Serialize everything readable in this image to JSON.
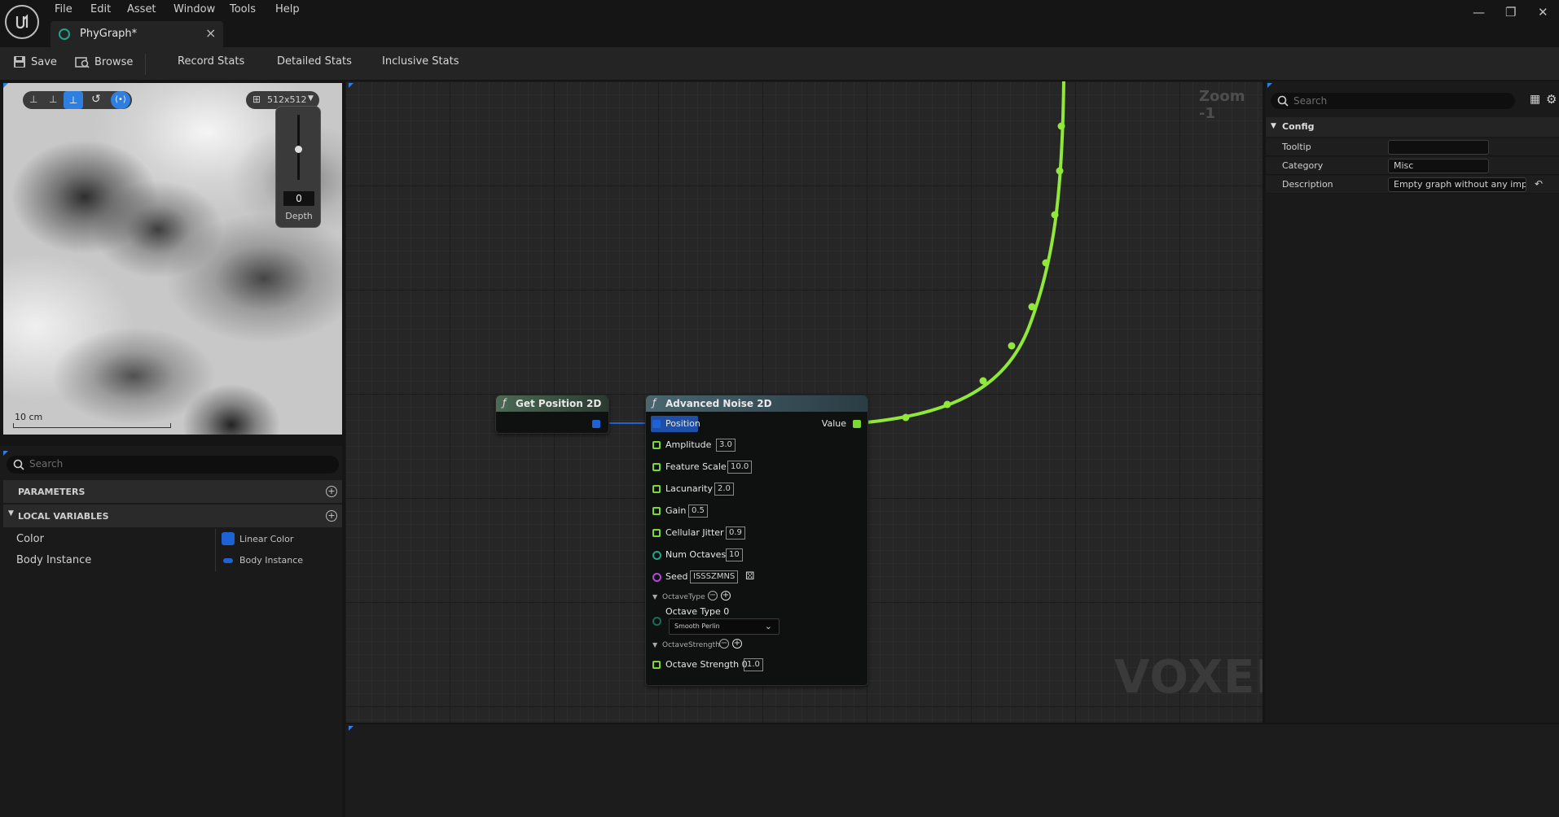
{
  "menu": [
    "File",
    "Edit",
    "Asset",
    "Window",
    "Tools",
    "Help"
  ],
  "tab": {
    "label": "PhyGraph*"
  },
  "toolbar": {
    "save_label": "Save",
    "browse_label": "Browse",
    "record_stats_label": "Record Stats",
    "detailed_stats_label": "Detailed Stats",
    "inclusive_stats_label": "Inclusive Stats"
  },
  "preview": {
    "resolution": "512x512",
    "depth_value": "0",
    "depth_label": "Depth",
    "scale_label": "10 cm"
  },
  "left_panel": {
    "search_placeholder": "Search",
    "parameters_label": "PARAMETERS",
    "local_variables_label": "LOCAL VARIABLES",
    "variables": [
      {
        "name": "Color",
        "type": "Linear Color",
        "color": "#1e63d6"
      },
      {
        "name": "Body Instance",
        "type": "Body Instance",
        "color": "#1e63d6"
      }
    ]
  },
  "graph": {
    "zoom_label": "Zoom -1",
    "watermark": "VOXEL",
    "wire_color": "#8fe83a",
    "nodes": {
      "get_position": {
        "title": "Get Position 2D",
        "header_color": "#4c6a55"
      },
      "advanced_noise": {
        "title": "Advanced Noise 2D",
        "header_color": "#4a6670",
        "position_label": "Position",
        "output_label": "Value",
        "pins": [
          {
            "label": "Amplitude",
            "value": "3.0"
          },
          {
            "label": "Feature Scale",
            "value": "10.0"
          },
          {
            "label": "Lacunarity",
            "value": "2.0"
          },
          {
            "label": "Gain",
            "value": "0.5"
          },
          {
            "label": "Cellular Jitter",
            "value": "0.9"
          },
          {
            "label": "Num Octaves",
            "value": "10"
          },
          {
            "label": "Seed",
            "value": "ISSSZMNS"
          }
        ],
        "octave_type_header": "OctaveType",
        "octave_type_label": "Octave Type 0",
        "octave_type_value": "Smooth Perlin",
        "octave_strength_header": "OctaveStrength",
        "octave_strength_label": "Octave Strength 0",
        "octave_strength_value": "1.0"
      }
    }
  },
  "details": {
    "search_placeholder": "Search",
    "section_label": "Config",
    "props": [
      {
        "name": "Tooltip",
        "value": ""
      },
      {
        "name": "Category",
        "value": "Misc"
      },
      {
        "name": "Description",
        "value": "Empty graph without any imple"
      }
    ]
  }
}
